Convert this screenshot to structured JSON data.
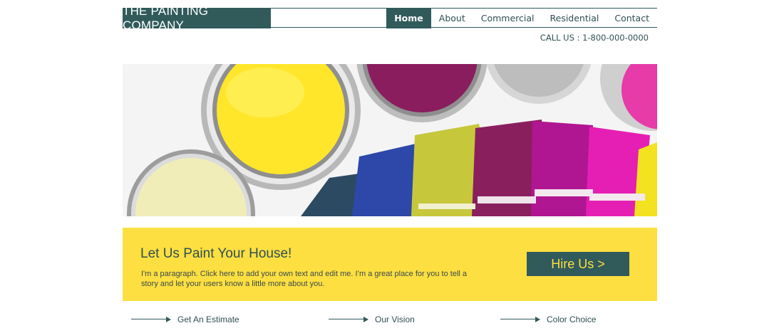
{
  "header": {
    "logo": "THE PAINTING COMPANY",
    "nav": [
      "Home",
      "About",
      "Commercial",
      "Residential",
      "Contact"
    ],
    "active": "Home",
    "phone": "CALL US : 1-800-000-0000"
  },
  "hero": {
    "image": "paint-cans-and-swatches"
  },
  "banner": {
    "title": "Let Us Paint Your House!",
    "text": "I'm a paragraph. Click here to add your own text and edit me. I’m a great place for you to tell a story and let your users know a little more about you.",
    "button": "Hire Us >"
  },
  "links": [
    "Get An Estimate",
    "Our Vision",
    "Color Choice"
  ],
  "colors": {
    "primary": "#315a5b",
    "accent": "#fddf41"
  }
}
